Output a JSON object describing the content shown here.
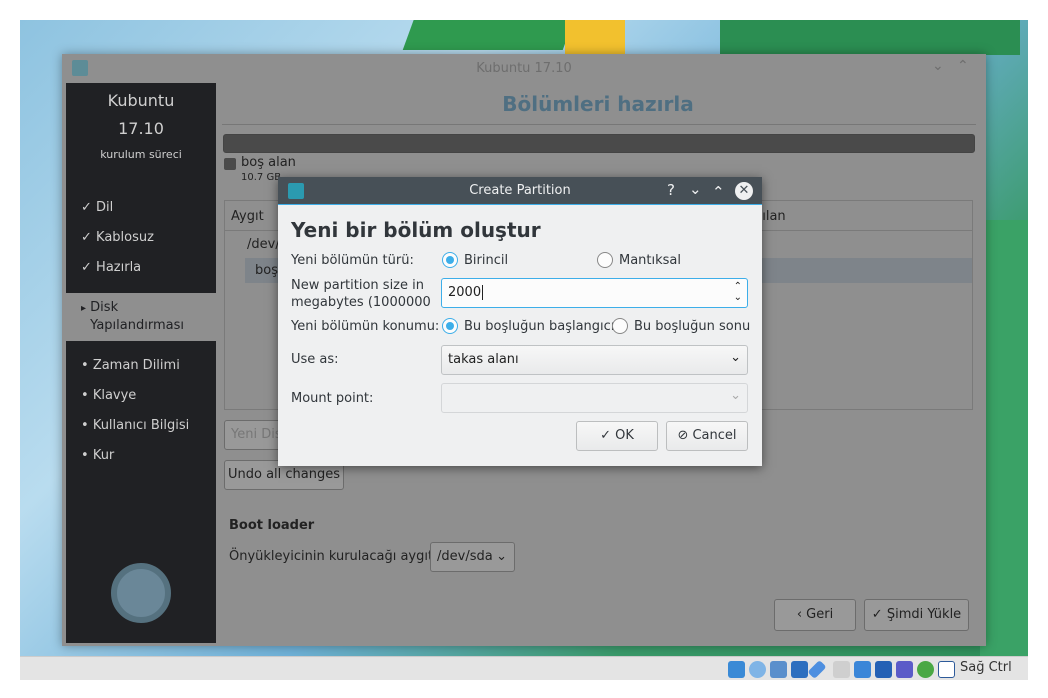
{
  "window": {
    "title": "Kubuntu 17.10"
  },
  "sidebar": {
    "product": "Kubuntu",
    "version": "17.10",
    "subtitle": "kurulum süreci",
    "items": [
      {
        "mark": "✓",
        "label": "Dil"
      },
      {
        "mark": "✓",
        "label": "Kablosuz"
      },
      {
        "mark": "✓",
        "label": "Hazırla"
      },
      {
        "mark": "▸",
        "label": "Disk Yapılandırması"
      },
      {
        "mark": "•",
        "label": "Zaman Dilimi"
      },
      {
        "mark": "•",
        "label": "Klavye"
      },
      {
        "mark": "•",
        "label": "Kullanıcı Bilgisi"
      },
      {
        "mark": "•",
        "label": "Kur"
      }
    ]
  },
  "main": {
    "heading": "Bölümleri hazırla",
    "legend_label": "boş alan",
    "legend_size": "10.7 GB",
    "table": {
      "col1": "Aygıt",
      "col2_partial": "nılan",
      "row1": "/dev/",
      "row2": "boş"
    },
    "new_table_button": "Yeni Dis",
    "undo_button": "Undo all changes",
    "bootloader_heading": "Boot loader",
    "bootloader_label": "Önyükleyicinin kurulacağı aygıt:",
    "bootloader_value": "/dev/sda",
    "back_button": "Geri",
    "install_button": "Şimdi Yükle"
  },
  "dialog": {
    "title": "Create Partition",
    "heading": "Yeni bir bölüm oluştur",
    "type_label": "Yeni bölümün türü:",
    "type_primary": "Birincil",
    "type_logical": "Mantıksal",
    "size_label": "New partition size in megabytes (1000000",
    "size_value": "2000",
    "location_label": "Yeni bölümün konumu:",
    "loc_start": "Bu boşluğun başlangıcı",
    "loc_end": "Bu boşluğun sonu",
    "useas_label": "Use as:",
    "useas_value": "takas alanı",
    "mount_label": "Mount point:",
    "mount_value": "",
    "ok": "OK",
    "cancel": "Cancel",
    "help": "?"
  },
  "statusbar": {
    "host_key": "Sağ Ctrl"
  }
}
